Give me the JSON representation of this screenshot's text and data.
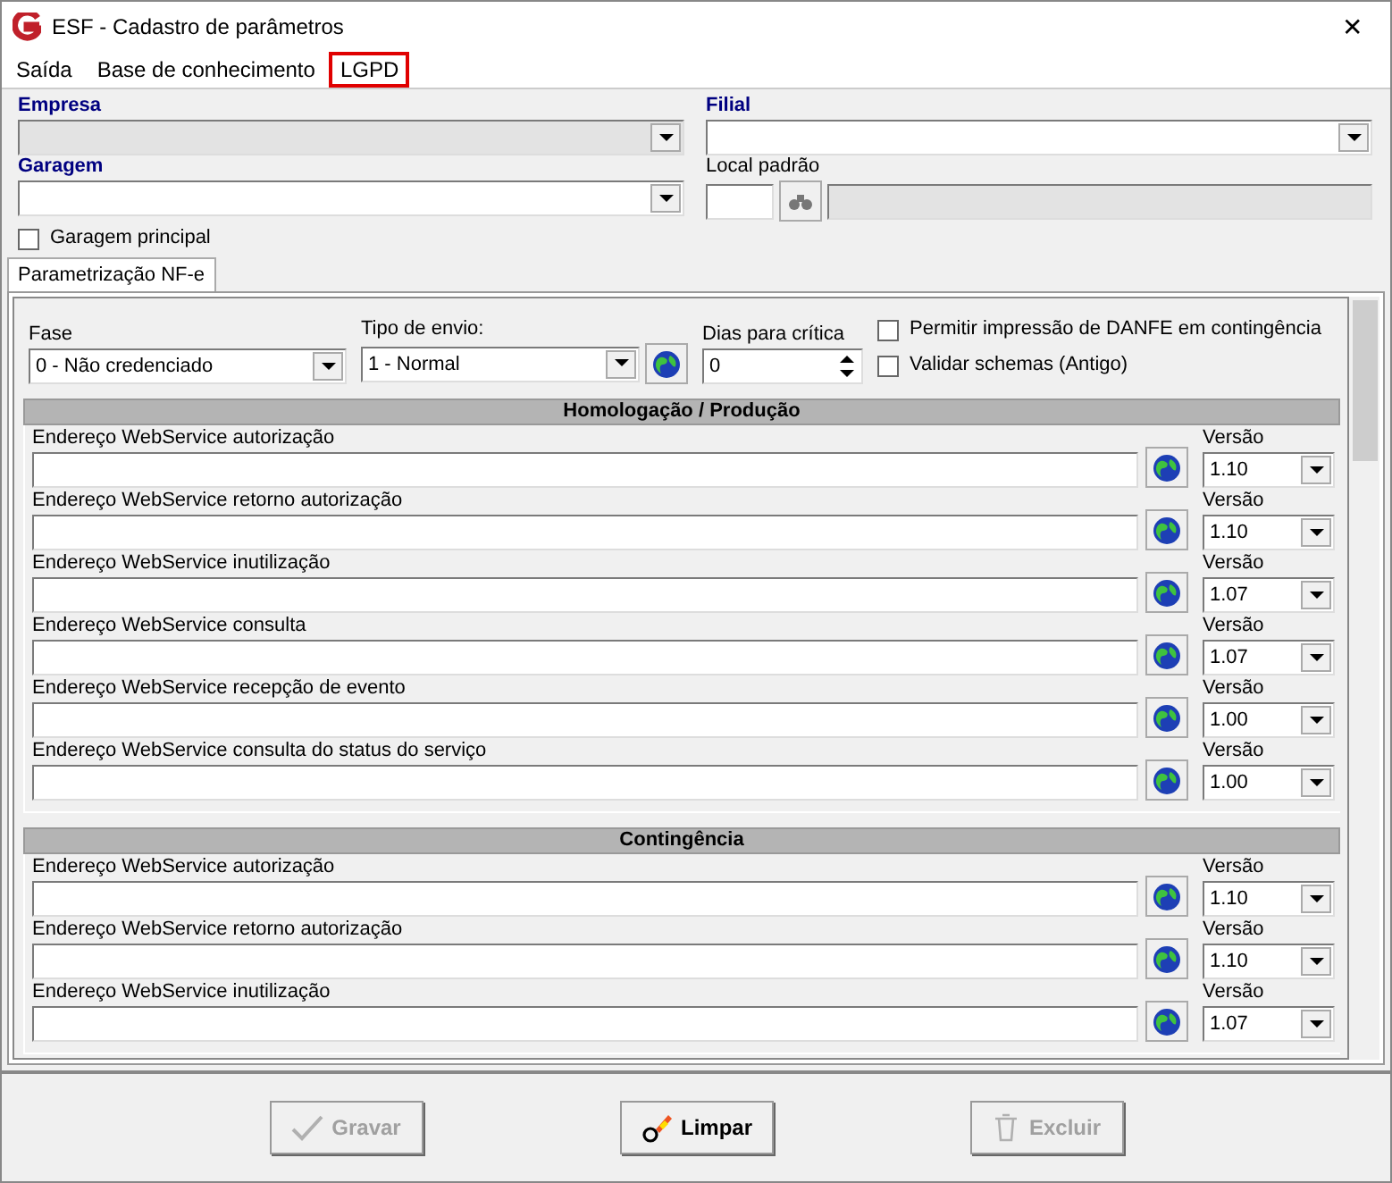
{
  "window": {
    "title": "ESF - Cadastro de parâmetros",
    "close": "✕"
  },
  "menu": [
    {
      "label": "Saída",
      "outlined": false
    },
    {
      "label": "Base de conhecimento",
      "outlined": false
    },
    {
      "label": "LGPD",
      "outlined": true
    }
  ],
  "header": {
    "empresa": {
      "label": "Empresa",
      "disabled": true
    },
    "filial": {
      "label": "Filial"
    },
    "garagem": {
      "label": "Garagem"
    },
    "local_padrao": {
      "label": "Local padrão"
    },
    "garagem_principal": {
      "label": "Garagem principal",
      "checked": false
    }
  },
  "tabs": [
    {
      "label": "Parametrização NF-e",
      "selected": true
    }
  ],
  "config": {
    "fase": {
      "label": "Fase",
      "value": "0 - Não credenciado"
    },
    "tipo_envio": {
      "label": "Tipo de envio:",
      "value": "1 - Normal"
    },
    "dias": {
      "label": "Dias para crítica",
      "value": "0"
    },
    "options": [
      {
        "label": "Permitir impressão de DANFE em contingência",
        "checked": false
      },
      {
        "label": "Validar schemas (Antigo)",
        "checked": false
      }
    ]
  },
  "sections": [
    {
      "title": "Homologação / Produção",
      "rows": [
        {
          "label": "Endereço WebService autorização",
          "version_label": "Versão",
          "version": "1.10"
        },
        {
          "label": "Endereço WebService retorno autorização",
          "version_label": "Versão",
          "version": "1.10"
        },
        {
          "label": "Endereço WebService inutilização",
          "version_label": "Versão",
          "version": "1.07"
        },
        {
          "label": "Endereço WebService consulta",
          "version_label": "Versão",
          "version": "1.07"
        },
        {
          "label": "Endereço WebService recepção de evento",
          "version_label": "Versão",
          "version": "1.00"
        },
        {
          "label": "Endereço WebService consulta do status do serviço",
          "version_label": "Versão",
          "version": "1.00"
        }
      ]
    },
    {
      "title": "Contingência",
      "rows": [
        {
          "label": "Endereço WebService autorização",
          "version_label": "Versão",
          "version": "1.10"
        },
        {
          "label": "Endereço WebService retorno autorização",
          "version_label": "Versão",
          "version": "1.10"
        },
        {
          "label": "Endereço WebService inutilização",
          "version_label": "Versão",
          "version": "1.07"
        }
      ]
    }
  ],
  "buttons": [
    {
      "label": "Gravar",
      "kind": "save",
      "disabled": true
    },
    {
      "label": "Limpar",
      "kind": "clear",
      "disabled": false
    },
    {
      "label": "Excluir",
      "kind": "delete",
      "disabled": true
    }
  ]
}
